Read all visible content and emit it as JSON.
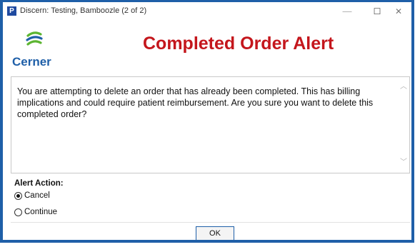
{
  "window": {
    "app_icon_letter": "P",
    "title": "Discern: Testing, Bamboozle (2 of 2)",
    "minimize_glyph": "—",
    "maximize_glyph": "☐",
    "close_glyph": "✕"
  },
  "header": {
    "logo_text": "Cerner",
    "alert_title": "Completed Order Alert"
  },
  "message": {
    "text": "You are attempting to delete an order that has already been completed. This has billing implications and could require patient reimbursement. Are you sure you want to delete this completed order?"
  },
  "alert_action": {
    "label": "Alert Action:",
    "options": [
      {
        "label": "Cancel",
        "selected": true
      },
      {
        "label": "Continue",
        "selected": false
      }
    ]
  },
  "buttons": {
    "ok_label": "OK"
  },
  "colors": {
    "window_border": "#1f5fa8",
    "alert_title": "#c4161c",
    "logo_blue": "#1f5fa8",
    "logo_green": "#5cb531"
  }
}
